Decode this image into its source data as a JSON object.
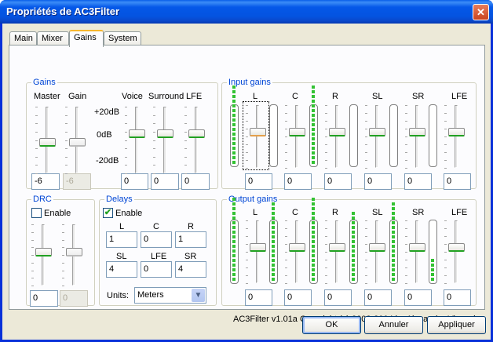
{
  "window": {
    "title": "Propriétés de AC3Filter",
    "close_glyph": "✕"
  },
  "tabs": [
    "Main",
    "Mixer",
    "Gains",
    "System"
  ],
  "gains": {
    "title": "Gains",
    "master_label": "Master",
    "gain_label": "Gain",
    "voice_label": "Voice",
    "surround_label": "Surround",
    "lfe_label": "LFE",
    "scale": [
      "+20dB",
      "0dB",
      "-20dB"
    ],
    "master_value": "-6",
    "gain_value": "-6",
    "voice_value": "0",
    "surround_value": "0",
    "lfe_value": "0"
  },
  "input_gains": {
    "title": "Input gains",
    "channels": [
      "L",
      "C",
      "R",
      "SL",
      "SR",
      "LFE"
    ],
    "values": [
      "0",
      "0",
      "0",
      "0",
      "0",
      "0"
    ]
  },
  "output_gains": {
    "title": "Output gains",
    "channels": [
      "L",
      "C",
      "R",
      "SL",
      "SR",
      "LFE"
    ],
    "values": [
      "0",
      "0",
      "0",
      "0",
      "0",
      "0"
    ]
  },
  "drc": {
    "title": "DRC",
    "enable_label": "Enable",
    "enabled": false,
    "value1": "0",
    "value2": "0"
  },
  "delays": {
    "title": "Delays",
    "enable_label": "Enable",
    "enabled": true,
    "row1_labels": [
      "L",
      "C",
      "R"
    ],
    "row1_values": [
      "1",
      "0",
      "1"
    ],
    "row2_labels": [
      "SL",
      "LFE",
      "SR"
    ],
    "row2_values": [
      "4",
      "0",
      "4"
    ],
    "units_label": "Units:",
    "units_value": "Meters"
  },
  "copyright": "AC3Filter v1.01a Copyright (c) 2002-2004 by Alexander Vigovsky",
  "buttons": {
    "ok": "OK",
    "cancel": "Annuler",
    "apply": "Appliquer"
  },
  "check_glyph": "✔",
  "dropdown_glyph": "▼"
}
